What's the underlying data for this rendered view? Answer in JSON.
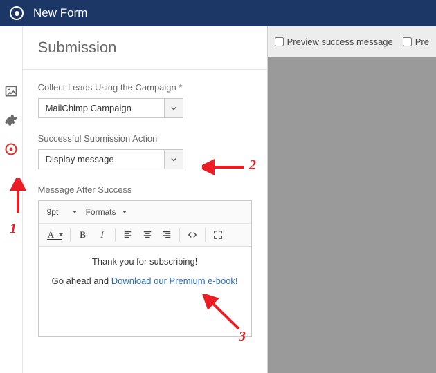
{
  "header": {
    "title": "New Form"
  },
  "sidebar": {
    "items": [
      {
        "name": "image-icon"
      },
      {
        "name": "gear-icon"
      },
      {
        "name": "target-icon",
        "active": true
      }
    ]
  },
  "panel": {
    "title": "Submission",
    "campaign": {
      "label": "Collect Leads Using the Campaign *",
      "value": "MailChimp Campaign"
    },
    "action": {
      "label": "Successful Submission Action",
      "value": "Display message"
    },
    "message_label": "Message After Success",
    "editor": {
      "font_size": "9pt",
      "formats_label": "Formats",
      "content_line1": "Thank you for subscribing!",
      "content_line2_prefix": "Go ahead and ",
      "content_line2_link": "Download our Premium e-book!"
    }
  },
  "right": {
    "preview_success_label": "Preview success message",
    "preview_trunc_label": "Pre"
  },
  "annotations": {
    "n1": "1",
    "n2": "2",
    "n3": "3"
  }
}
